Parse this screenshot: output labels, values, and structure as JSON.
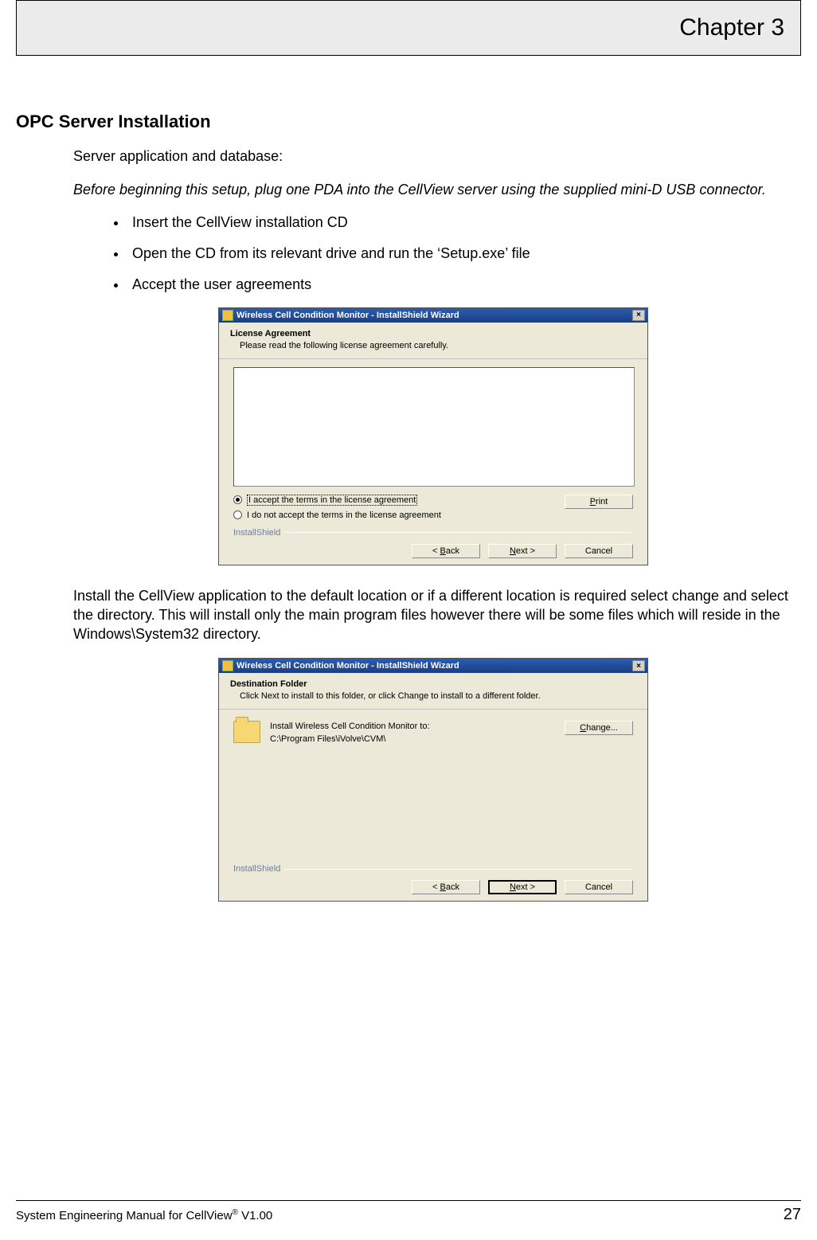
{
  "header": {
    "chapter": "Chapter 3"
  },
  "section_title": "OPC Server Installation",
  "intro": "Server application and database:",
  "intro_italic": "Before beginning this setup, plug one PDA into the CellView server using the supplied mini-D USB connector.",
  "bullets": [
    "Insert the CellView installation CD",
    "Open the CD from its relevant drive and run the ‘Setup.exe’ file",
    "Accept the user agreements"
  ],
  "dialog1": {
    "title": "Wireless Cell Condition Monitor - InstallShield Wizard",
    "heading": "License Agreement",
    "subheading": "Please read the following license agreement carefully.",
    "radio_accept": "I accept the terms in the license agreement",
    "radio_reject": "I do not accept the terms in the license agreement",
    "print_label": "Print",
    "brand": "InstallShield",
    "back_label": "< Back",
    "next_label": "Next >",
    "cancel_label": "Cancel"
  },
  "mid_paragraph": "Install the CellView application to the default location or if a different location is required select change and select the directory. This will install only the main program files however there will be some files which will reside in the Windows\\System32 directory.",
  "dialog2": {
    "title": "Wireless Cell Condition Monitor - InstallShield Wizard",
    "heading": "Destination Folder",
    "subheading": "Click Next to install to this folder, or click Change to install to a different folder.",
    "install_to_label": "Install Wireless Cell Condition Monitor to:",
    "install_path": "C:\\Program Files\\iVolve\\CVM\\",
    "change_label": "Change...",
    "brand": "InstallShield",
    "back_label": "< Back",
    "next_label": "Next >",
    "cancel_label": "Cancel"
  },
  "footer": {
    "manual_prefix": "System Engineering Manual for CellView",
    "reg": "®",
    "version": " V1.00",
    "page": "27"
  }
}
